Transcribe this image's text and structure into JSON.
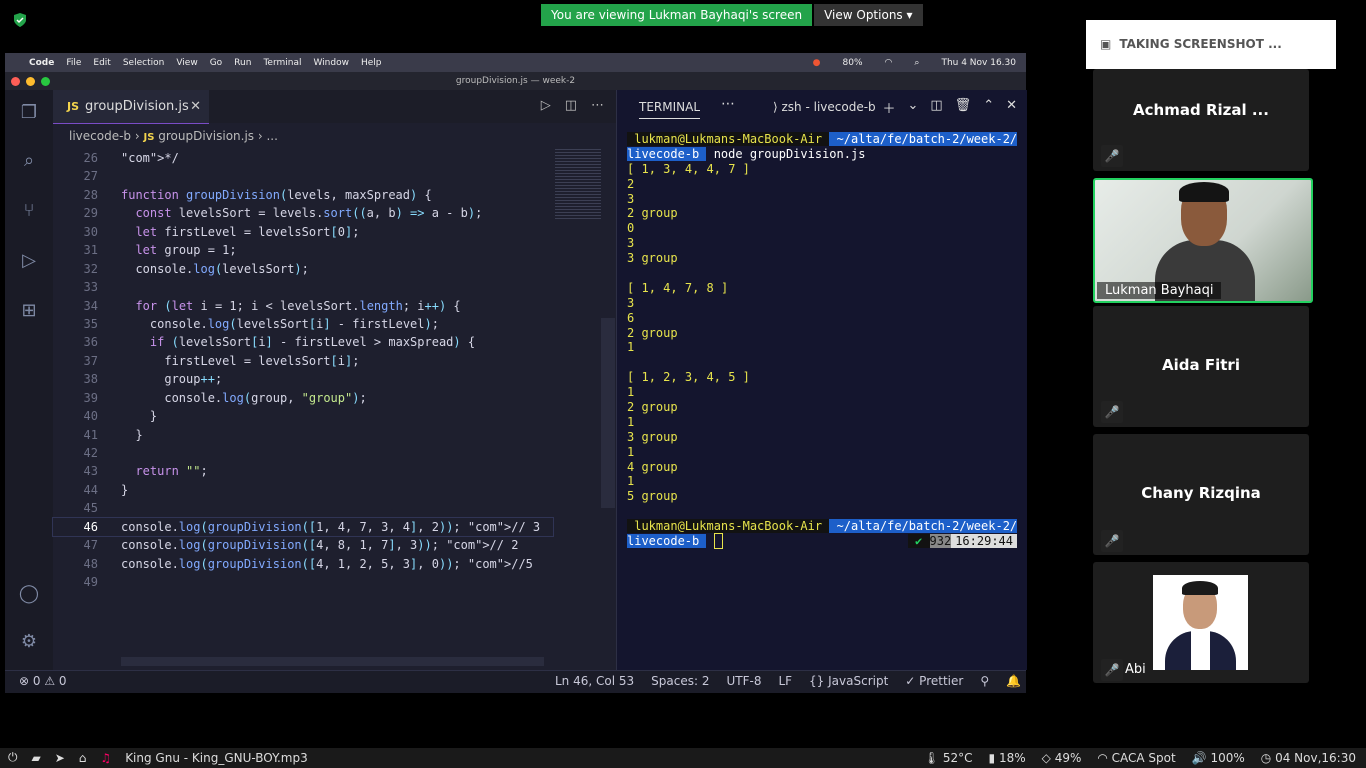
{
  "zoom": {
    "banner_text": "You are viewing Lukman Bayhaqi's screen",
    "view_options": "View Options",
    "screenshot_notice": "TAKING  SCREENSHOT ...",
    "participants": [
      {
        "name": "Achmad Rizal ...",
        "muted": true
      },
      {
        "name": "Lukman Bayhaqi",
        "video": true
      },
      {
        "name": "Aida Fitri",
        "muted": true
      },
      {
        "name": "Chany Rizqina",
        "muted": true
      },
      {
        "name": "Abi",
        "muted": true,
        "photo": true
      }
    ]
  },
  "mac_menubar": {
    "app": "Code",
    "menus": [
      "File",
      "Edit",
      "Selection",
      "View",
      "Go",
      "Run",
      "Terminal",
      "Window",
      "Help"
    ],
    "battery": "80%",
    "datetime": "Thu 4 Nov  16.30"
  },
  "window_title": "groupDivision.js — week-2",
  "editor": {
    "tab_label": "groupDivision.js",
    "tab_lang": "JS",
    "breadcrumb": [
      "livecode-b",
      "groupDivision.js",
      "..."
    ],
    "lines": [
      {
        "n": "26",
        "html_key": "l26"
      },
      {
        "n": "27"
      },
      {
        "n": "28"
      },
      {
        "n": "29"
      },
      {
        "n": "30"
      },
      {
        "n": "31"
      },
      {
        "n": "32"
      },
      {
        "n": "33"
      },
      {
        "n": "34"
      },
      {
        "n": "35"
      },
      {
        "n": "36"
      },
      {
        "n": "37"
      },
      {
        "n": "38"
      },
      {
        "n": "39"
      },
      {
        "n": "40"
      },
      {
        "n": "41"
      },
      {
        "n": "42"
      },
      {
        "n": "43"
      },
      {
        "n": "44"
      },
      {
        "n": "45"
      },
      {
        "n": "46"
      },
      {
        "n": "47"
      },
      {
        "n": "48"
      },
      {
        "n": "49"
      }
    ],
    "code_text": [
      "*/",
      "",
      "function groupDivision(levels, maxSpread) {",
      "  const levelsSort = levels.sort((a, b) => a - b);",
      "  let firstLevel = levelsSort[0];",
      "  let group = 1;",
      "  console.log(levelsSort);",
      "",
      "  for (let i = 1; i < levelsSort.length; i++) {",
      "    console.log(levelsSort[i] - firstLevel);",
      "    if (levelsSort[i] - firstLevel > maxSpread) {",
      "      firstLevel = levelsSort[i];",
      "      group++;",
      "      console.log(group, \"group\");",
      "    }",
      "  }",
      "",
      "  return \"\";",
      "}",
      "",
      "console.log(groupDivision([1, 4, 7, 3, 4], 2)); // 3",
      "console.log(groupDivision([4, 8, 1, 7], 3)); // 2",
      "console.log(groupDivision([4, 1, 2, 5, 3], 0)); //5",
      ""
    ]
  },
  "terminal": {
    "tab": "TERMINAL",
    "shell": "zsh - livecode-b",
    "prompt_user": " lukman@Lukmans-MacBook-Air ",
    "prompt_path1": " ~/alta/fe/batch-2/week-2/",
    "prompt_path2": "livecode-b ",
    "command": " node groupDivision.js",
    "output": [
      "[ 1, 3, 4, 4, 7 ]",
      "2",
      "3",
      "2 group",
      "0",
      "3",
      "3 group",
      "",
      "[ 1, 4, 7, 8 ]",
      "3",
      "6",
      "2 group",
      "1",
      "",
      "[ 1, 2, 3, 4, 5 ]",
      "1",
      "2 group",
      "1",
      "3 group",
      "1",
      "4 group",
      "1",
      "5 group",
      ""
    ],
    "right_status_num": "932",
    "right_status_time": "16:29:44"
  },
  "statusbar": {
    "problems": "⊗ 0 ⚠ 0",
    "position": "Ln 46, Col 53",
    "spaces": "Spaces: 2",
    "encoding": "UTF-8",
    "eol": "LF",
    "language": "{} JavaScript",
    "formatter": "✓ Prettier"
  },
  "taskbar": {
    "media": "King Gnu - King_GNU-BOY.mp3",
    "temp": "52°C",
    "cpu": "18%",
    "mem": "49%",
    "wifi": "CACA Spot",
    "volume": "100%",
    "datetime": "04 Nov,16:30"
  }
}
